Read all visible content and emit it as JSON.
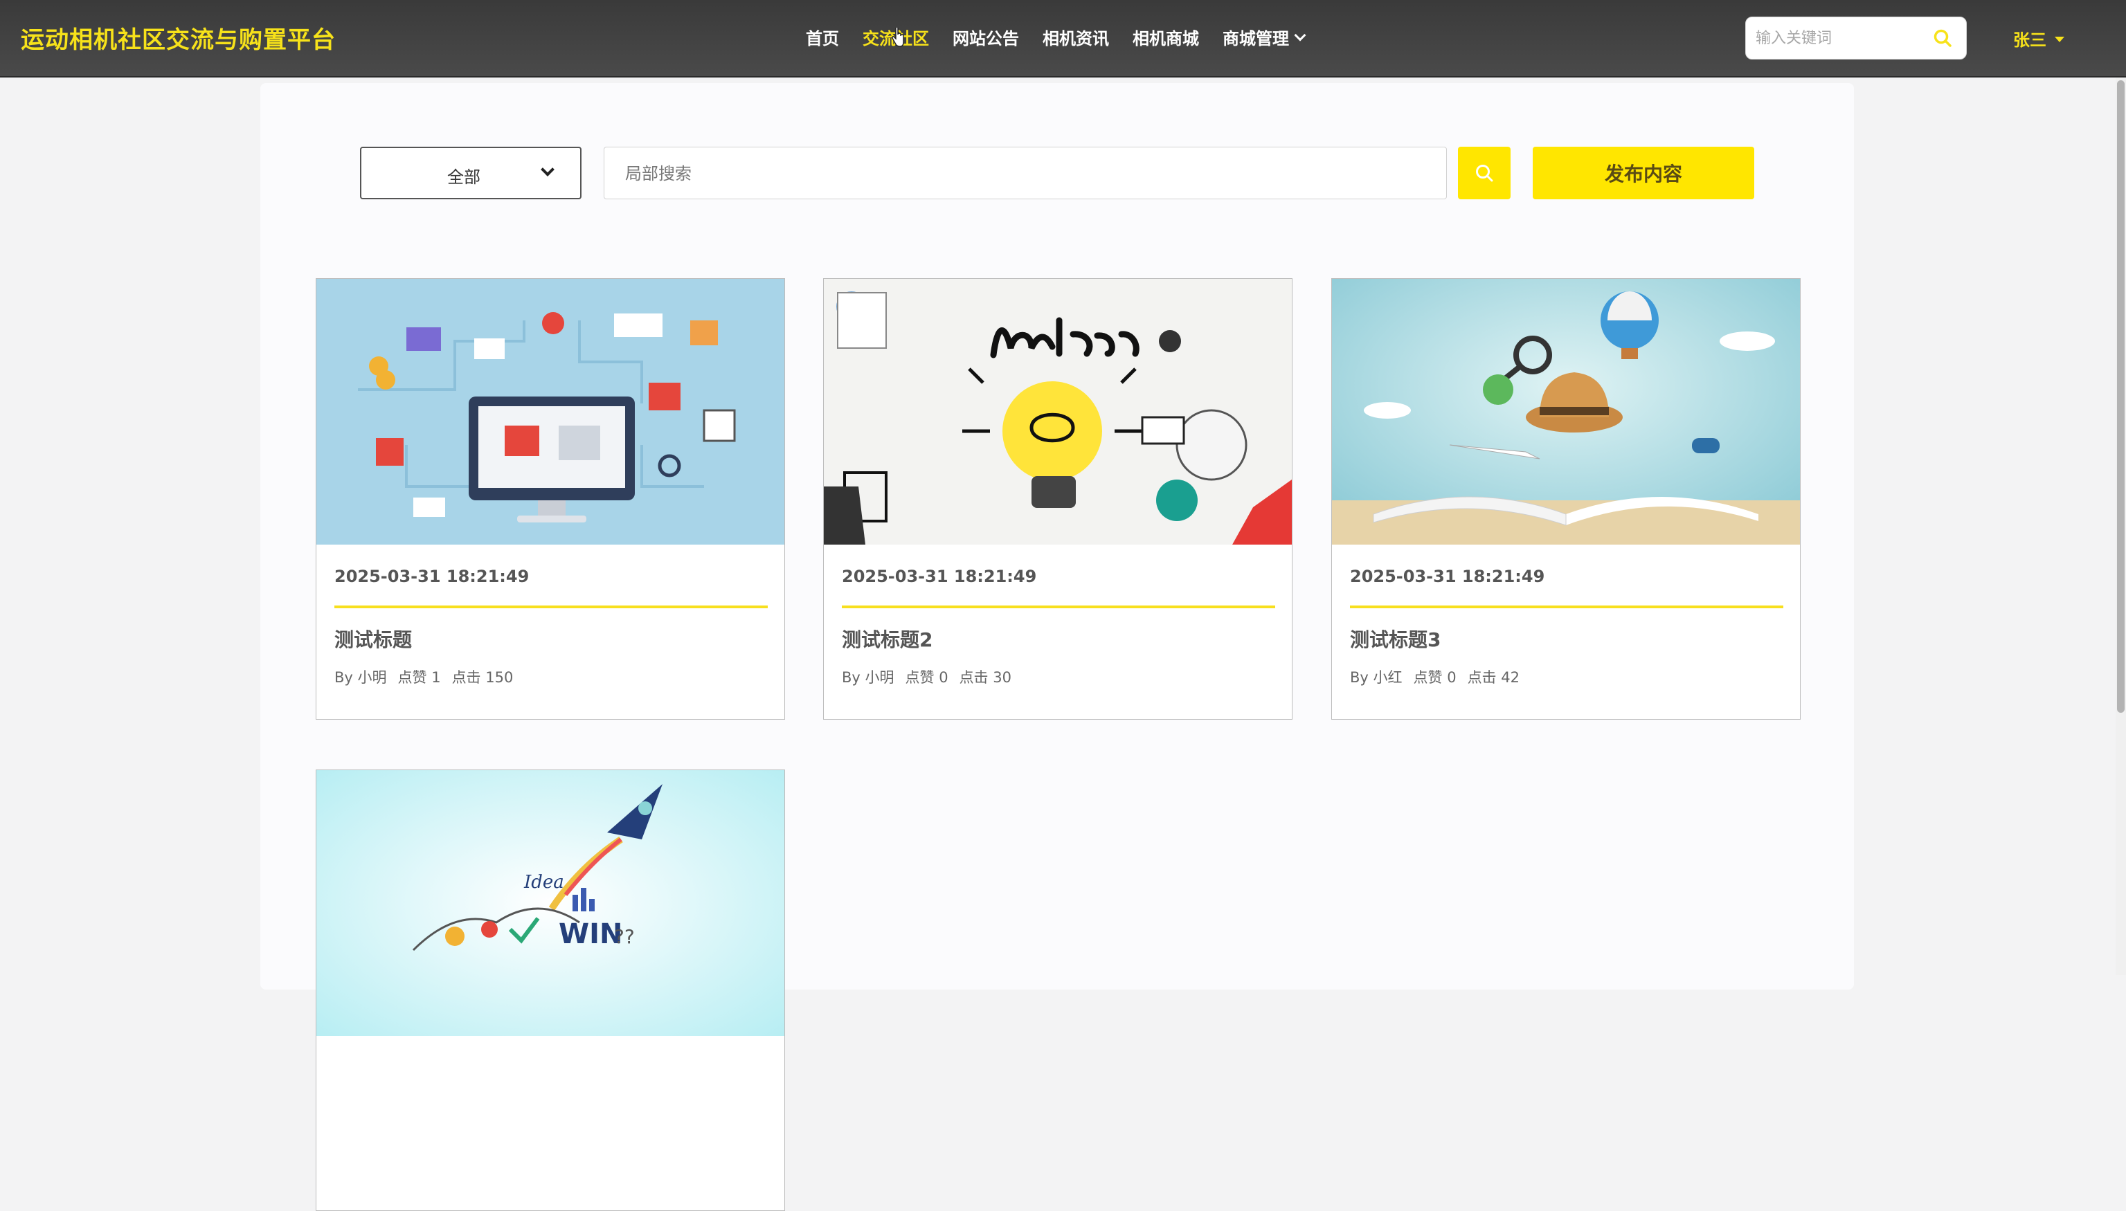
{
  "header": {
    "brand": "运动相机社区交流与购置平台",
    "nav": [
      {
        "label": "首页"
      },
      {
        "label": "交流社区",
        "active": true
      },
      {
        "label": "网站公告"
      },
      {
        "label": "相机资讯"
      },
      {
        "label": "相机商城"
      },
      {
        "label": "商城管理",
        "dropdown": true
      }
    ],
    "search_placeholder": "输入关键词",
    "user": "张三"
  },
  "toolbar": {
    "category_selected": "全部",
    "search_placeholder": "局部搜索",
    "publish_label": "发布内容"
  },
  "cards": [
    {
      "date": "2025-03-31 18:21:49",
      "title": "测试标题",
      "author": "By 小明",
      "likes": "点赞 1",
      "views": "点击 150",
      "image": "ecommerce-illustration"
    },
    {
      "date": "2025-03-31 18:21:49",
      "title": "测试标题2",
      "author": "By 小明",
      "likes": "点赞 0",
      "views": "点击 30",
      "image": "learn-lightbulb-illustration"
    },
    {
      "date": "2025-03-31 18:21:49",
      "title": "测试标题3",
      "author": "By 小红",
      "likes": "点赞 0",
      "views": "点击 42",
      "image": "open-book-travel-illustration"
    },
    {
      "date": "",
      "title": "",
      "author": "",
      "likes": "",
      "views": "",
      "image": "rocket-idea-illustration"
    }
  ],
  "colors": {
    "accent": "#ffe600",
    "brand_text": "#f7e21a",
    "header_bg": "#404040"
  }
}
